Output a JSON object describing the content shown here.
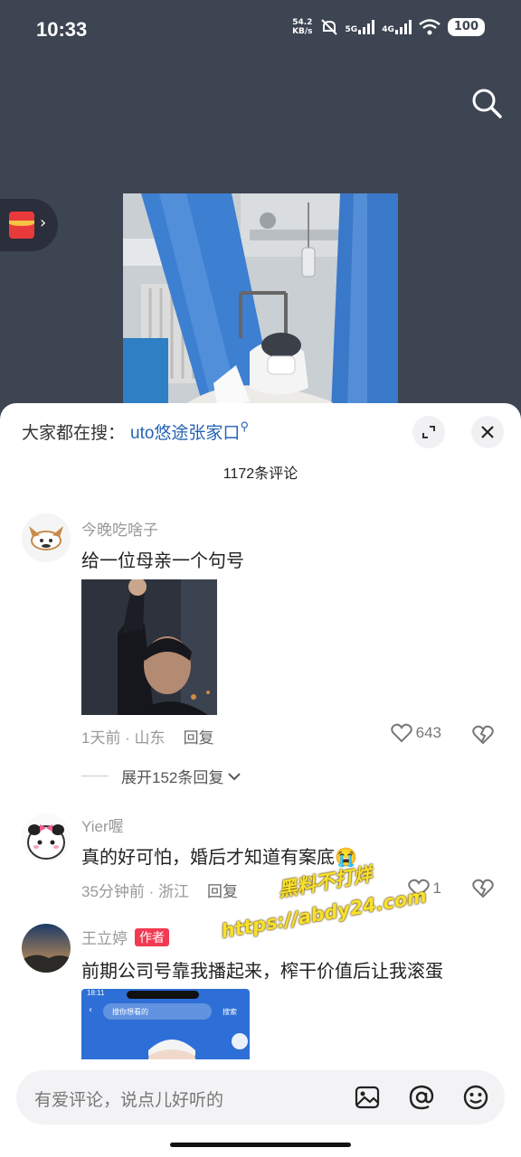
{
  "status_bar": {
    "time": "10:33",
    "net_speed_top": "54.2",
    "net_speed_bottom": "KB/s",
    "sim1": "5G",
    "sim2": "4G",
    "battery": "100"
  },
  "sheet": {
    "search_prefix": "大家都在搜：",
    "search_keyword": "uto悠途张家口",
    "comment_count": "1172条评论"
  },
  "comments": [
    {
      "user": "今晚吃啥子",
      "text": "给一位母亲一个句号",
      "meta": "1天前 · 山东",
      "reply": "回复",
      "likes": "643",
      "expand": "展开152条回复"
    },
    {
      "user": "Yier喔",
      "text": "真的好可怕，婚后才知道有案底😭",
      "meta": "35分钟前 · 浙江",
      "reply": "回复",
      "likes": "1"
    },
    {
      "user": "王立婷",
      "author_tag": "作者",
      "text": "前期公司号靠我播起来，榨干价值后让我滚蛋",
      "thumb_status_time": "18:11",
      "thumb_search_placeholder": "搜你想看的",
      "thumb_search_button": "搜索"
    }
  ],
  "input": {
    "placeholder": "有爱评论，说点儿好听的"
  },
  "watermark": {
    "line1": "黑料不打烊",
    "line2": "https://abdy24.com"
  },
  "colors": {
    "keyword": "#2563b5",
    "author_tag": "#f23a53",
    "background_dark": "#3d4452"
  }
}
